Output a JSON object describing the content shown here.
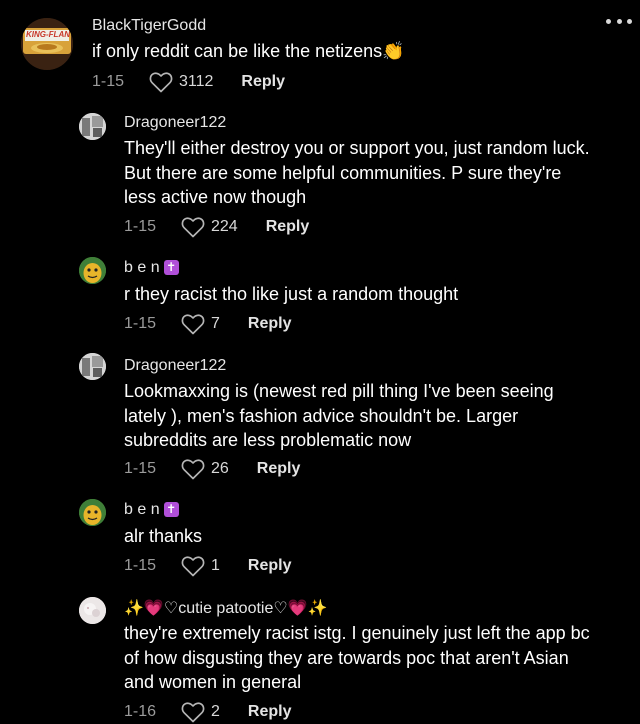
{
  "comments": [
    {
      "username": "BlackTigerGodd",
      "text": "if only reddit can be like the netizens👏",
      "date": "1-15",
      "likes": "3112",
      "reply": "Reply",
      "avatar_label": "KING-FLAN"
    },
    {
      "username": "Dragoneer122",
      "text": "They'll either destroy you or support you, just random luck. But there are some helpful communities. P sure they're less active now though",
      "date": "1-15",
      "likes": "224",
      "reply": "Reply"
    },
    {
      "username": "b e n",
      "badge": "✝",
      "text": "r they racist tho like just a random thought",
      "date": "1-15",
      "likes": "7",
      "reply": "Reply"
    },
    {
      "username": "Dragoneer122",
      "text": "Lookmaxxing is (newest red pill thing I've been seeing lately ), men's fashion advice shouldn't be. Larger subreddits are less problematic now",
      "date": "1-15",
      "likes": "26",
      "reply": "Reply"
    },
    {
      "username": "b e n",
      "badge": "✝",
      "text": "alr thanks",
      "date": "1-15",
      "likes": "1",
      "reply": "Reply"
    },
    {
      "username": "✨💗♡cutie patootie♡💗✨",
      "text": "they're extremely racist istg. I genuinely just left the app bc of how disgusting they are towards poc that aren't Asian and women in general",
      "date": "1-16",
      "likes": "2",
      "reply": "Reply"
    }
  ]
}
